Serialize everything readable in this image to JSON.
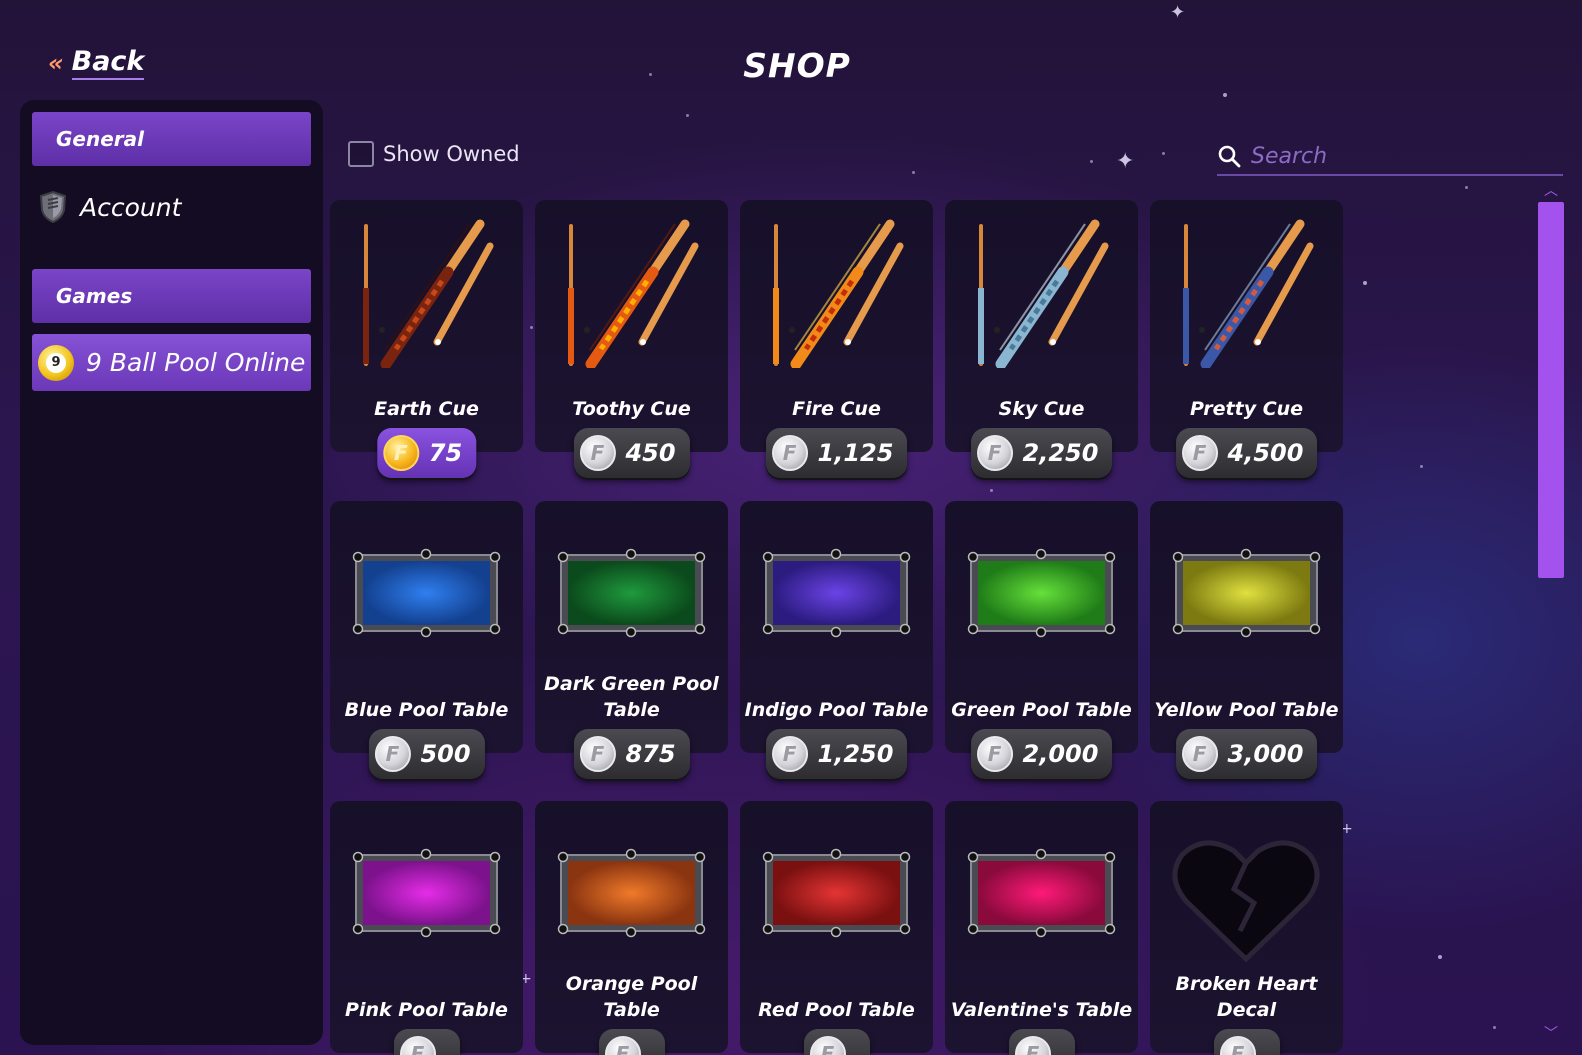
{
  "header": {
    "back_label": "Back",
    "title": "SHOP"
  },
  "sidebar": {
    "sections": [
      {
        "header": "General",
        "items": [
          {
            "label": "Account",
            "icon": "shield-icon",
            "active": false
          }
        ]
      },
      {
        "header": "Games",
        "items": [
          {
            "label": "9 Ball Pool Online",
            "icon": "nine-ball-icon",
            "active": true
          }
        ]
      }
    ]
  },
  "toolbar": {
    "show_owned_label": "Show Owned",
    "show_owned_checked": false
  },
  "search": {
    "placeholder": "Search",
    "value": ""
  },
  "currency": {
    "gold_coin_color": "#f7b61d",
    "silver_coin_color": "#d4d4da",
    "coin_letter": "F"
  },
  "items": [
    {
      "name": "Earth Cue",
      "price": "75",
      "coin": "gold",
      "kind": "cue",
      "colors": [
        "#7a2410",
        "#c9481a",
        "#3b0f06"
      ]
    },
    {
      "name": "Toothy Cue",
      "price": "450",
      "coin": "silver",
      "kind": "cue",
      "colors": [
        "#e55a12",
        "#ffb000",
        "#7a1f00"
      ]
    },
    {
      "name": "Fire Cue",
      "price": "1,125",
      "coin": "silver",
      "kind": "cue",
      "colors": [
        "#f28a1a",
        "#c42d0a",
        "#ffd34a"
      ]
    },
    {
      "name": "Sky Cue",
      "price": "2,250",
      "coin": "silver",
      "kind": "cue",
      "colors": [
        "#8ab6d2",
        "#4b7a99",
        "#d9ecf4"
      ]
    },
    {
      "name": "Pretty Cue",
      "price": "4,500",
      "coin": "silver",
      "kind": "cue",
      "colors": [
        "#3b58a8",
        "#d35a3a",
        "#a0c4e0"
      ]
    },
    {
      "name": "Blue Pool Table",
      "price": "500",
      "coin": "silver",
      "kind": "table",
      "colors": [
        "#2f7ff0",
        "#13408f"
      ]
    },
    {
      "name": "Dark Green Pool Table",
      "price": "875",
      "coin": "silver",
      "kind": "table",
      "colors": [
        "#1f9a3d",
        "#0b4a1c"
      ]
    },
    {
      "name": "Indigo Pool Table",
      "price": "1,250",
      "coin": "silver",
      "kind": "table",
      "colors": [
        "#6b43e6",
        "#2c1c80"
      ]
    },
    {
      "name": "Green Pool Table",
      "price": "2,000",
      "coin": "silver",
      "kind": "table",
      "colors": [
        "#66e03a",
        "#1f7c18"
      ]
    },
    {
      "name": "Yellow Pool Table",
      "price": "3,000",
      "coin": "silver",
      "kind": "table",
      "colors": [
        "#e0e040",
        "#7c7a10"
      ]
    },
    {
      "name": "Pink Pool Table",
      "price": "",
      "coin": "silver",
      "kind": "table",
      "colors": [
        "#e62ce8",
        "#7c128c"
      ]
    },
    {
      "name": "Orange Pool Table",
      "price": "",
      "coin": "silver",
      "kind": "table",
      "colors": [
        "#f07a2a",
        "#8a3410"
      ]
    },
    {
      "name": "Red Pool Table",
      "price": "",
      "coin": "silver",
      "kind": "table",
      "colors": [
        "#e53434",
        "#7a1010"
      ]
    },
    {
      "name": "Valentine's Table",
      "price": "",
      "coin": "silver",
      "kind": "table",
      "colors": [
        "#ff1a78",
        "#8a0a3c"
      ]
    },
    {
      "name": "Broken Heart Decal",
      "price": "",
      "coin": "silver",
      "kind": "decal",
      "colors": [
        "#000000",
        "#2a2233"
      ]
    }
  ],
  "scrollbar": {
    "thumb_color": "#a352ee",
    "scroll_fraction_visible": 0.43,
    "scroll_position": 0.0
  }
}
